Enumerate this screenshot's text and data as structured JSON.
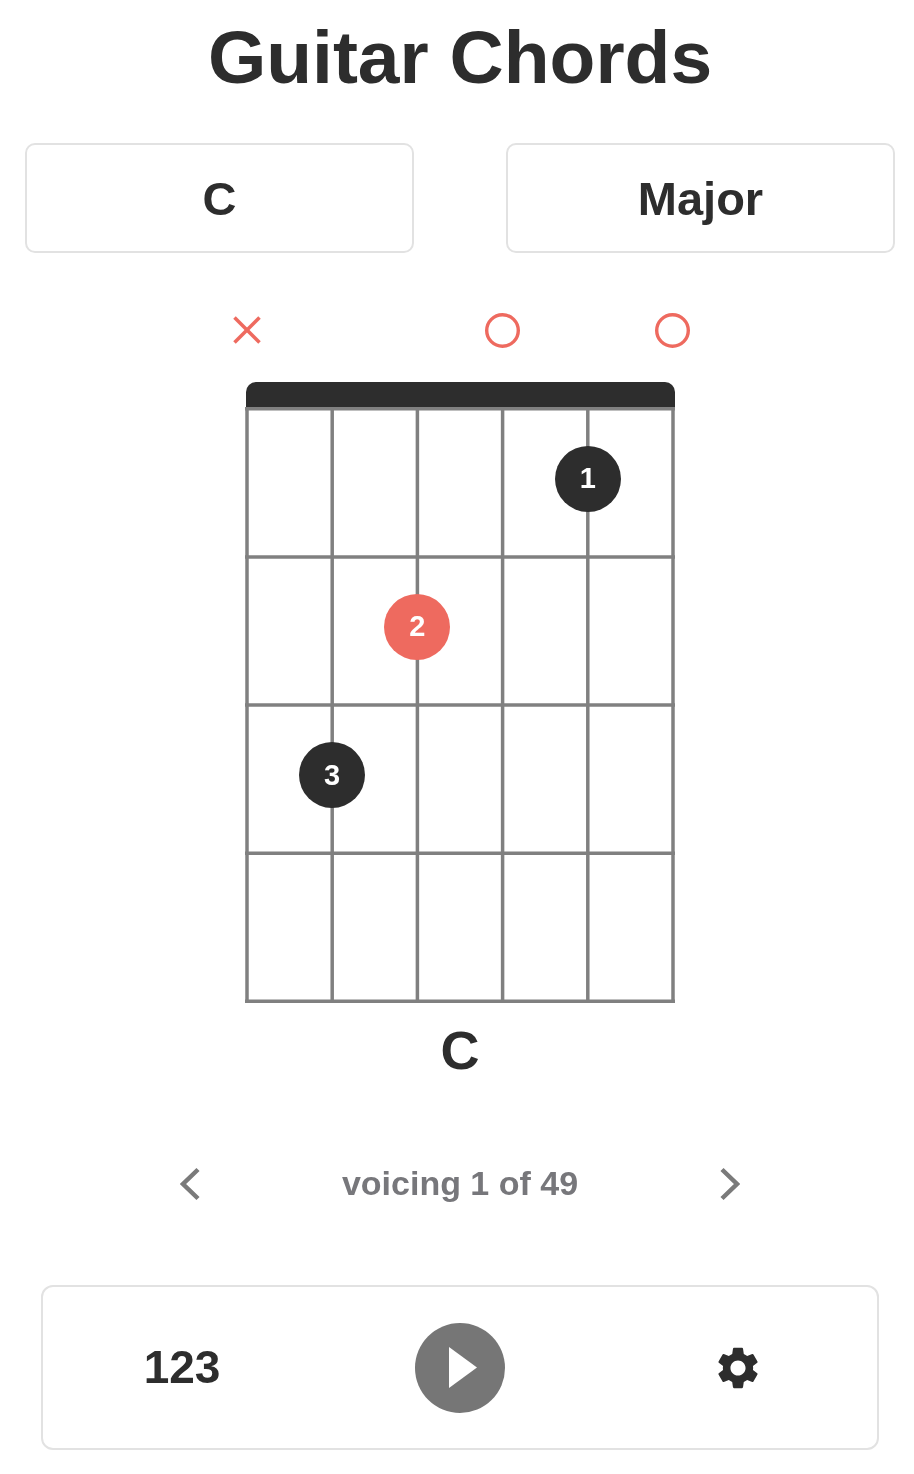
{
  "title": "Guitar Chords",
  "selectors": [
    {
      "value": "C"
    },
    {
      "value": "Major"
    }
  ],
  "chord_diagram": {
    "string_markers": [
      {
        "kind": "muted"
      },
      {
        "kind": "none"
      },
      {
        "kind": "none"
      },
      {
        "kind": "open"
      },
      {
        "kind": "none"
      },
      {
        "kind": "open"
      }
    ],
    "fret_rows": [
      {
        "positions": [
          {
            "kind": "empty"
          },
          {
            "kind": "empty"
          },
          {
            "kind": "empty"
          },
          {
            "kind": "empty"
          },
          {
            "kind": "finger",
            "label": "1",
            "color": "#2d2d2d"
          },
          {
            "kind": "empty"
          }
        ]
      },
      {
        "positions": [
          {
            "kind": "empty"
          },
          {
            "kind": "empty"
          },
          {
            "kind": "finger",
            "label": "2",
            "color": "#ee6a5f"
          },
          {
            "kind": "empty"
          },
          {
            "kind": "empty"
          },
          {
            "kind": "empty"
          }
        ]
      },
      {
        "positions": [
          {
            "kind": "empty"
          },
          {
            "kind": "finger",
            "label": "3",
            "color": "#2d2d2d"
          },
          {
            "kind": "empty"
          },
          {
            "kind": "empty"
          },
          {
            "kind": "empty"
          },
          {
            "kind": "empty"
          }
        ]
      },
      {
        "positions": [
          {
            "kind": "empty"
          },
          {
            "kind": "empty"
          },
          {
            "kind": "empty"
          },
          {
            "kind": "empty"
          },
          {
            "kind": "empty"
          },
          {
            "kind": "empty"
          }
        ]
      }
    ],
    "chord_name": "C"
  },
  "voicing": {
    "label": "voicing 1 of 49"
  },
  "toolbar": {
    "numbers_label": "123"
  }
}
